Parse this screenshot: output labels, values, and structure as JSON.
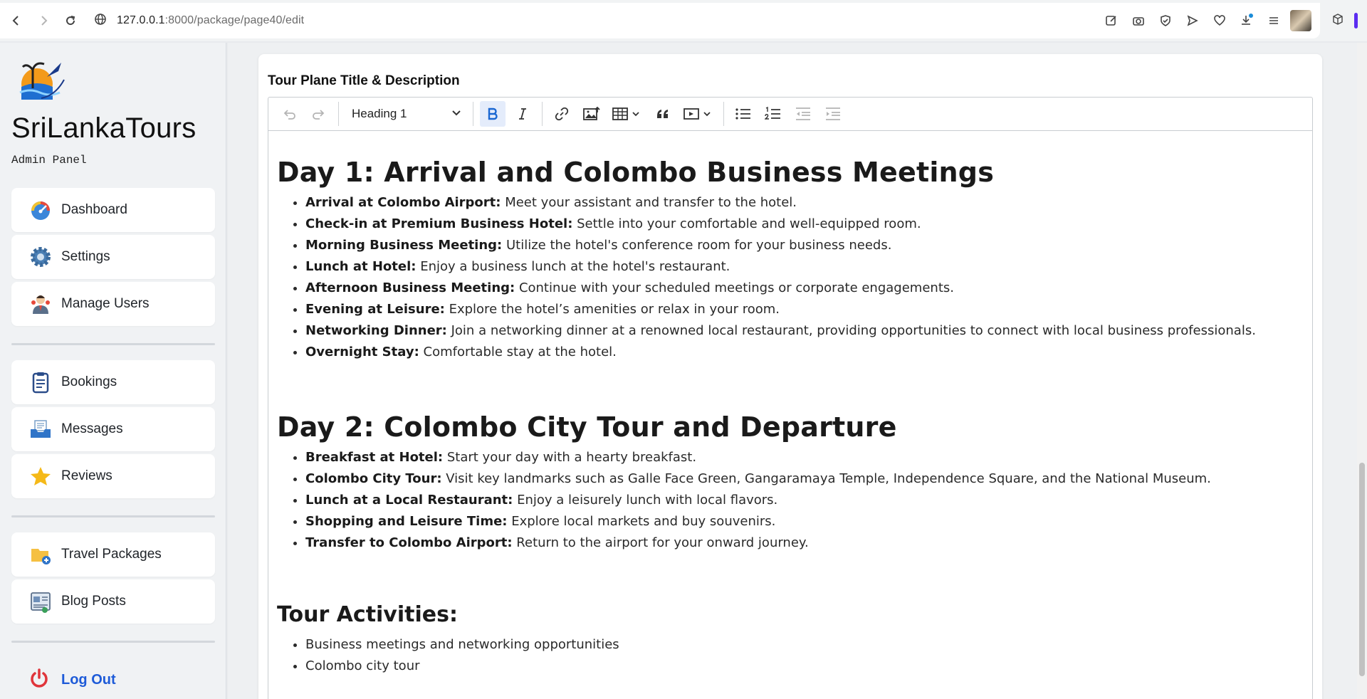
{
  "browser": {
    "url_host": "127.0.0.1",
    "url_rest": ":8000/package/page40/edit"
  },
  "sidebar": {
    "brand": "SriLankaTours",
    "subtitle": "Admin Panel",
    "items": [
      {
        "label": "Dashboard"
      },
      {
        "label": "Settings"
      },
      {
        "label": "Manage Users"
      },
      {
        "label": "Bookings"
      },
      {
        "label": "Messages"
      },
      {
        "label": "Reviews"
      },
      {
        "label": "Travel Packages"
      },
      {
        "label": "Blog Posts"
      }
    ],
    "logout": "Log Out"
  },
  "editor": {
    "section_title": "Tour Plane Title & Description",
    "heading_select": "Heading 1",
    "day1": {
      "heading": "Day 1: Arrival and Colombo Business Meetings",
      "items": [
        {
          "bold": "Arrival at Colombo Airport:",
          "text": " Meet your assistant and transfer to the hotel."
        },
        {
          "bold": "Check-in at Premium Business Hotel:",
          "text": " Settle into your comfortable and well-equipped room."
        },
        {
          "bold": "Morning Business Meeting:",
          "text": " Utilize the hotel's conference room for your business needs."
        },
        {
          "bold": "Lunch at Hotel:",
          "text": " Enjoy a business lunch at the hotel's restaurant."
        },
        {
          "bold": "Afternoon Business Meeting:",
          "text": " Continue with your scheduled meetings or corporate engagements."
        },
        {
          "bold": "Evening at Leisure:",
          "text": " Explore the hotel’s amenities or relax in your room."
        },
        {
          "bold": "Networking Dinner:",
          "text": " Join a networking dinner at a renowned local restaurant, providing opportunities to connect with local business professionals."
        },
        {
          "bold": "Overnight Stay:",
          "text": " Comfortable stay at the hotel."
        }
      ]
    },
    "day2": {
      "heading": "Day 2: Colombo City Tour and Departure",
      "items": [
        {
          "bold": "Breakfast at Hotel:",
          "text": " Start your day with a hearty breakfast."
        },
        {
          "bold": "Colombo City Tour:",
          "text": " Visit key landmarks such as Galle Face Green, Gangaramaya Temple, Independence Square, and the National Museum."
        },
        {
          "bold": "Lunch at a Local Restaurant:",
          "text": " Enjoy a leisurely lunch with local flavors."
        },
        {
          "bold": "Shopping and Leisure Time:",
          "text": " Explore local markets and buy souvenirs."
        },
        {
          "bold": "Transfer to Colombo Airport:",
          "text": " Return to the airport for your onward journey."
        }
      ]
    },
    "activities": {
      "heading": "Tour Activities:",
      "items": [
        "Business meetings and networking opportunities",
        "Colombo city tour"
      ]
    }
  },
  "colors": {
    "accent": "#1a67d2",
    "logout": "#1e5bd8",
    "extension_badge": "#5b2cf0"
  },
  "icons": [
    "back-arrow-icon",
    "forward-arrow-icon",
    "reload-icon",
    "site-info-icon",
    "dashboard-gauge-icon",
    "settings-gear-icon",
    "manage-users-icon",
    "bookings-clipboard-icon",
    "messages-inbox-icon",
    "reviews-star-icon",
    "travel-packages-folder-icon",
    "blog-posts-icon",
    "power-icon"
  ]
}
